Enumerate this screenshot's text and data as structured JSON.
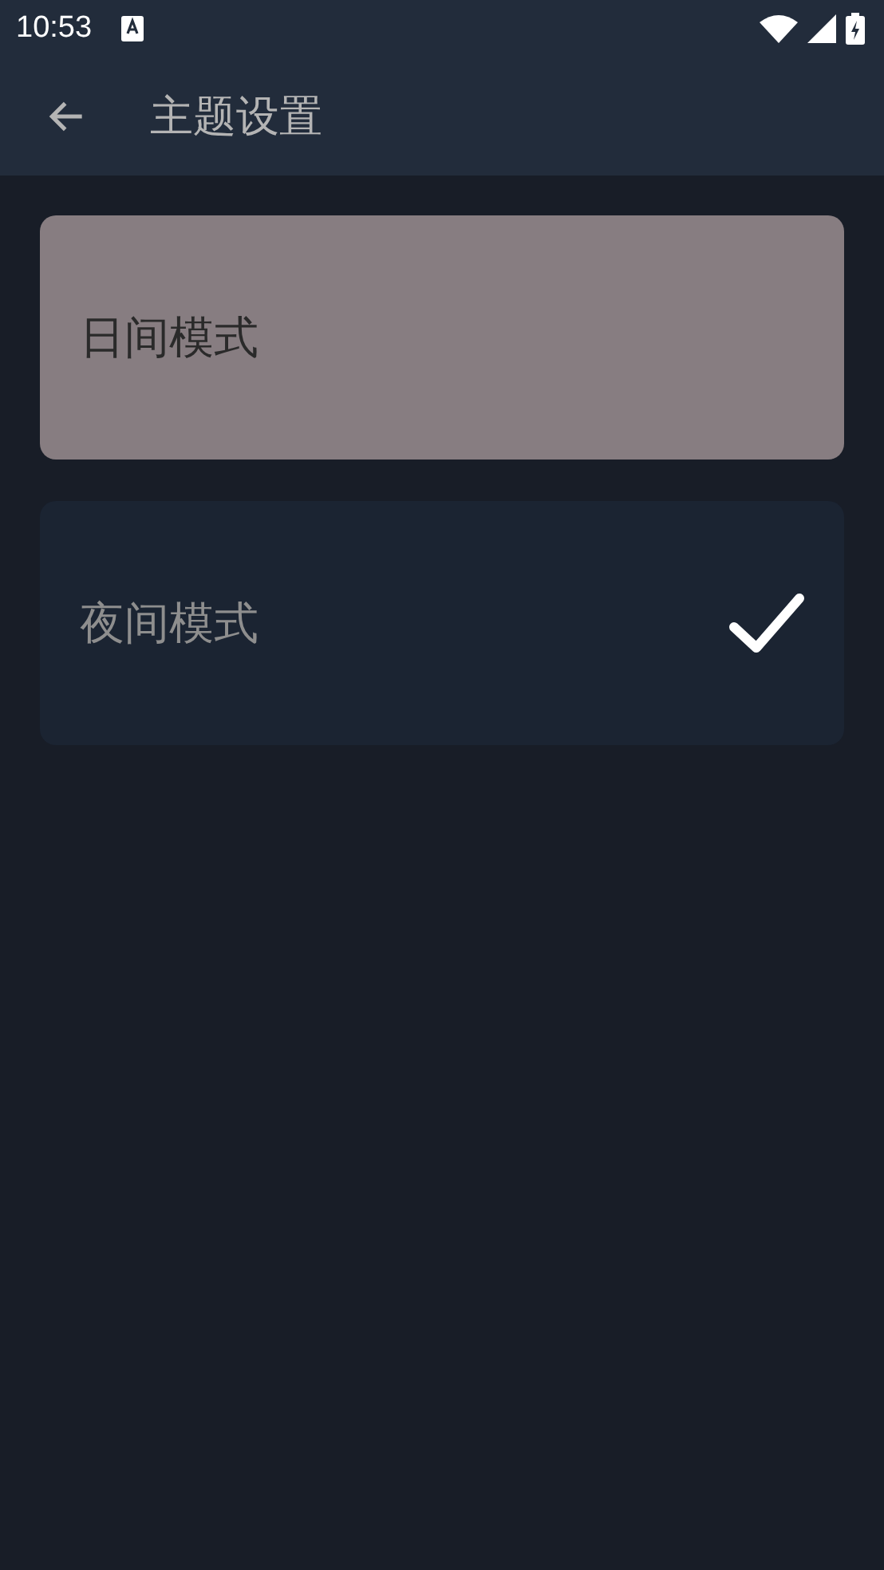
{
  "status_bar": {
    "time": "10:53"
  },
  "app_bar": {
    "title": "主题设置"
  },
  "themes": [
    {
      "label": "日间模式",
      "kind": "light",
      "selected": false
    },
    {
      "label": "夜间模式",
      "kind": "dark",
      "selected": true
    }
  ]
}
